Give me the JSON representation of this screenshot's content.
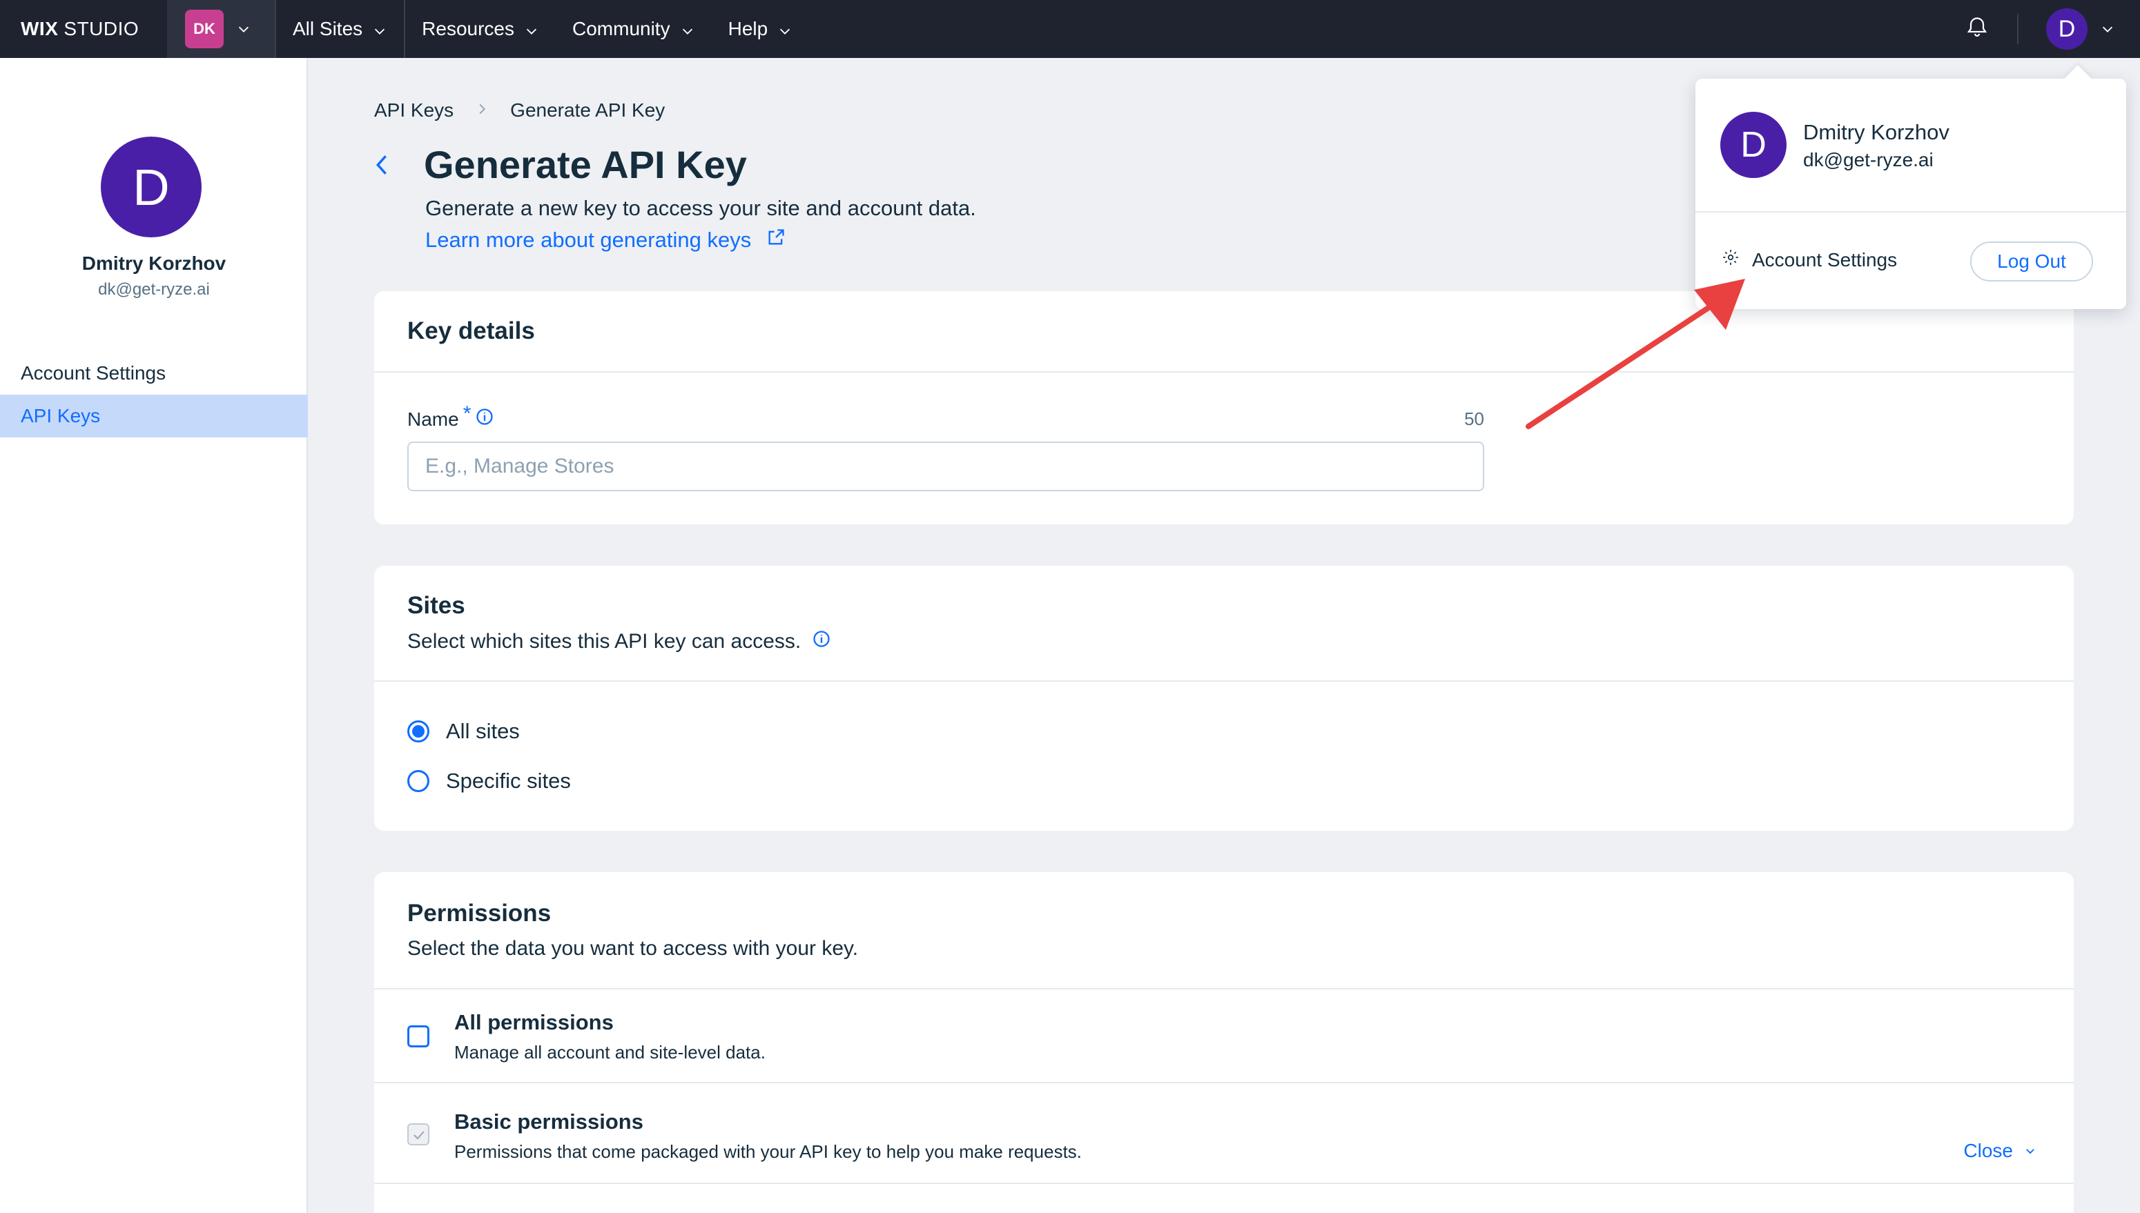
{
  "topbar": {
    "logo_bold": "WIX",
    "logo_light": "STUDIO",
    "account_badge": "DK",
    "nav": [
      "All Sites",
      "Resources",
      "Community",
      "Help"
    ],
    "avatar_letter": "D"
  },
  "sidebar": {
    "avatar_letter": "D",
    "name": "Dmitry Korzhov",
    "email": "dk@get-ryze.ai",
    "items": [
      {
        "label": "Account Settings",
        "active": false
      },
      {
        "label": "API Keys",
        "active": true
      }
    ]
  },
  "breadcrumb": [
    "API Keys",
    "Generate API Key"
  ],
  "page": {
    "title": "Generate API Key",
    "subtitle": "Generate a new key to access your site and account data.",
    "learn_more": "Learn more about generating keys"
  },
  "key_details": {
    "title": "Key details",
    "name_label": "Name",
    "required_mark": "*",
    "counter": "50",
    "placeholder": "E.g., Manage Stores"
  },
  "sites": {
    "title": "Sites",
    "subtitle": "Select which sites this API key can access.",
    "options": [
      {
        "label": "All sites",
        "checked": true
      },
      {
        "label": "Specific sites",
        "checked": false
      }
    ]
  },
  "permissions": {
    "title": "Permissions",
    "subtitle": "Select the data you want to access with your key.",
    "rows": [
      {
        "title": "All permissions",
        "desc": "Manage all account and site-level data."
      },
      {
        "title": "Basic permissions",
        "desc": "Permissions that come packaged with your API key to help you make requests.",
        "action": "Close"
      }
    ]
  },
  "dropdown": {
    "avatar_letter": "D",
    "name": "Dmitry Korzhov",
    "email": "dk@get-ryze.ai",
    "settings_label": "Account Settings",
    "logout_label": "Log Out"
  },
  "colors": {
    "topbar": "#1f2330",
    "accent": "#116dff",
    "avatar": "#4a1fa8",
    "badge": "#c83e91",
    "annotation": "#e8413f"
  }
}
